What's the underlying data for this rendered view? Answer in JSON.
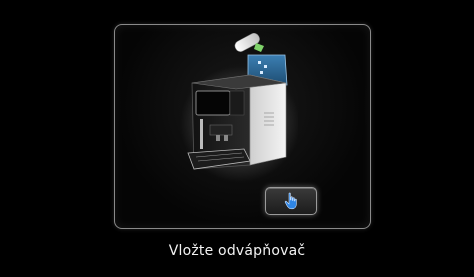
{
  "screen": {
    "message": "Vložte odvápňovač",
    "action_button_icon": "hand-tap-icon",
    "accent_color": "#2f86e6"
  },
  "illustration": {
    "subject": "coffee-machine-with-descaler-tablet",
    "water_tank_color": "#2d5f86"
  }
}
